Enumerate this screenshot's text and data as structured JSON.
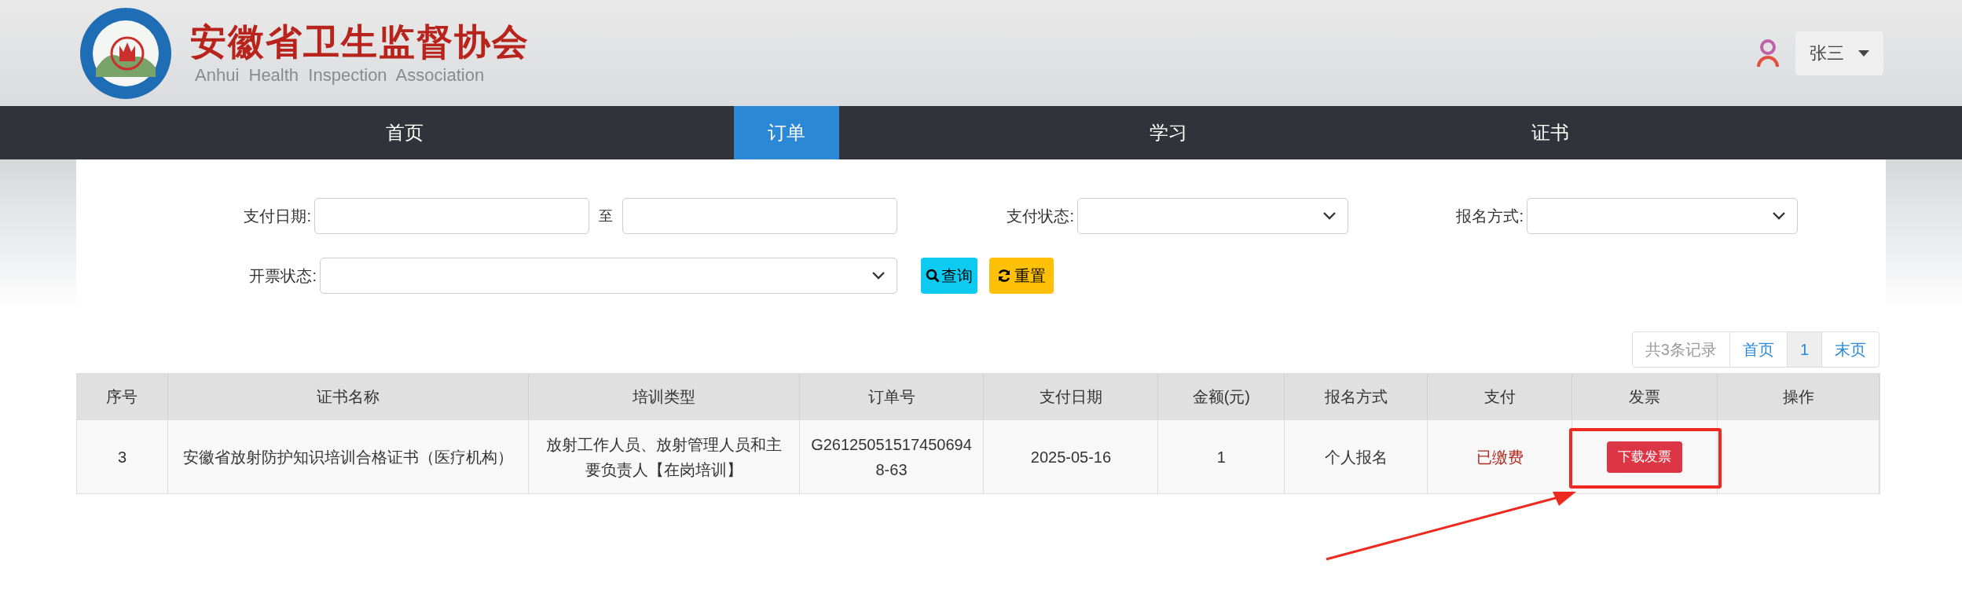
{
  "header": {
    "title": "安徽省卫生监督协会",
    "subtitle": "Anhui  Health  Inspection  Association"
  },
  "user": {
    "name": "张三"
  },
  "nav": [
    {
      "label": "首页",
      "selected": false
    },
    {
      "label": "订单",
      "selected": true
    },
    {
      "label": "学习",
      "selected": false
    },
    {
      "label": "证书",
      "selected": false
    }
  ],
  "filters": [
    {
      "label": "支付日期:",
      "kind": "date_range",
      "separator": "至"
    },
    {
      "label": "支付状态:",
      "kind": "select"
    },
    {
      "label": "报名方式:",
      "kind": "select"
    },
    {
      "label": "开票状态:",
      "kind": "select_wide"
    }
  ],
  "buttons": [
    {
      "label": "查询",
      "kind": "search"
    },
    {
      "label": "重置",
      "kind": "reset"
    }
  ],
  "pagination": {
    "total": "共3条记录",
    "first": "首页",
    "pages": [
      {
        "label": "1",
        "selected": true
      }
    ],
    "last": "末页"
  },
  "table": {
    "columns": [
      "序号",
      "证书名称",
      "培训类型",
      "订单号",
      "支付日期",
      "金额(元)",
      "报名方式",
      "支付",
      "发票",
      "操作"
    ],
    "rows": [
      {
        "cells": [
          {
            "kind": "text",
            "text": "3"
          },
          {
            "kind": "text",
            "text": "安徽省放射防护知识培训合格证书（医疗机构）"
          },
          {
            "kind": "text",
            "text": "放射工作人员、放射管理人员和主要负责人【在岗培训】"
          },
          {
            "kind": "text",
            "text": "G261250515174506948-63"
          },
          {
            "kind": "text",
            "text": "2025-05-16"
          },
          {
            "kind": "text",
            "text": "1"
          },
          {
            "kind": "text",
            "text": "个人报名"
          },
          {
            "kind": "status",
            "text": "已缴费"
          },
          {
            "kind": "button",
            "text": "下载发票",
            "callout": true
          },
          {
            "kind": "empty"
          }
        ]
      }
    ]
  }
}
